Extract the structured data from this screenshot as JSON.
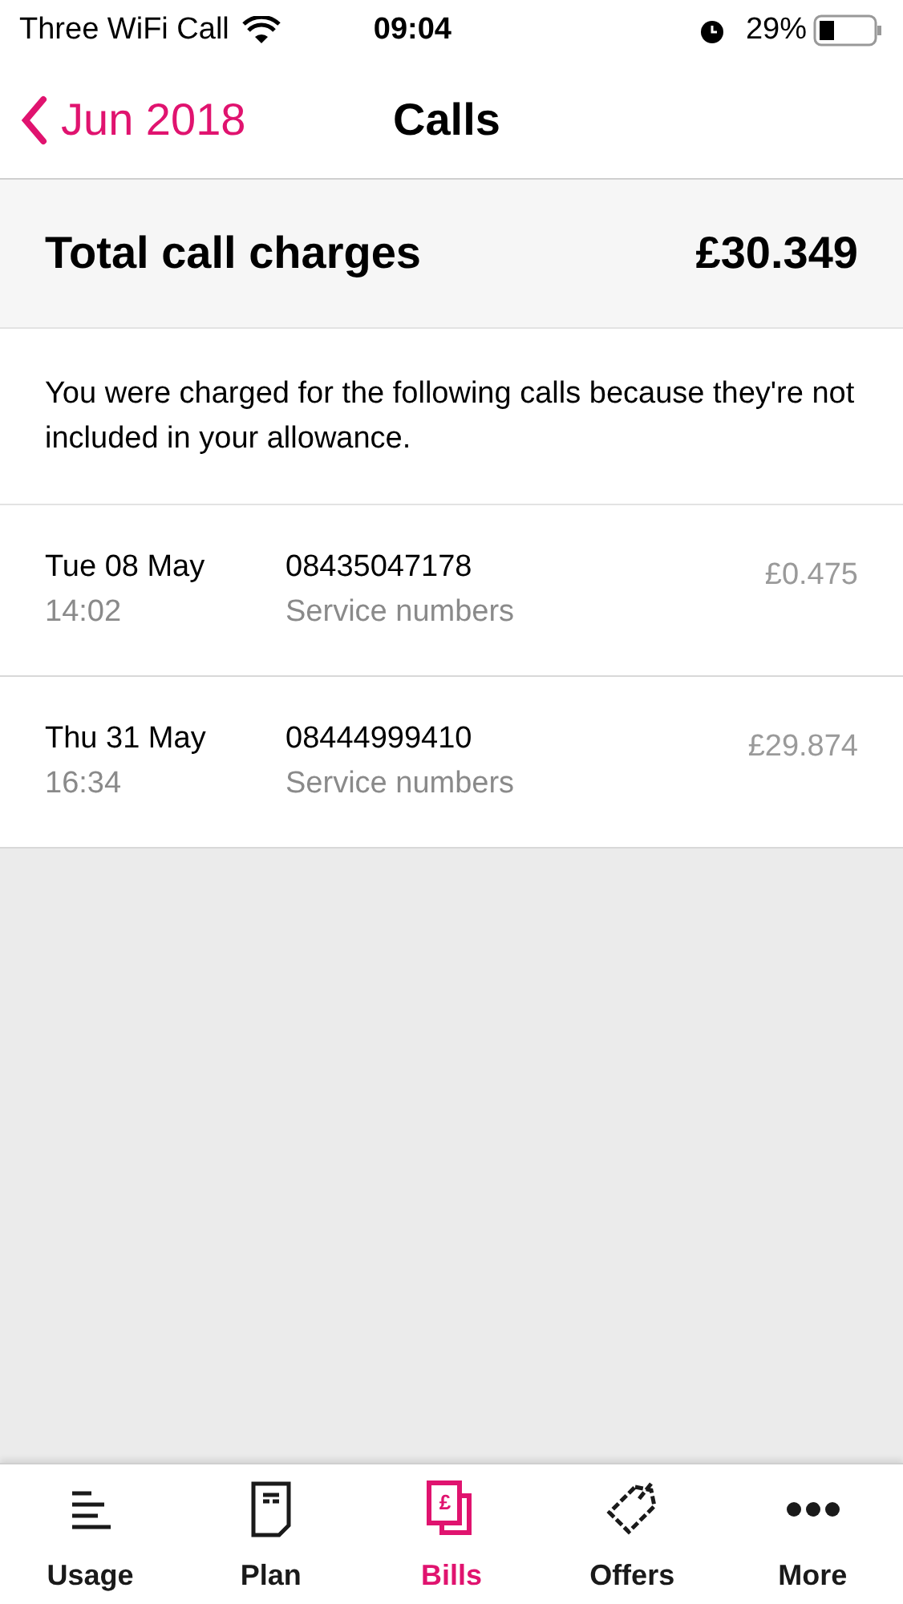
{
  "status_bar": {
    "carrier": "Three WiFi Call",
    "time": "09:04",
    "battery": "29%"
  },
  "nav": {
    "back": "Jun 2018",
    "title": "Calls"
  },
  "total": {
    "label": "Total call charges",
    "amount": "£30.349"
  },
  "intro": "You were charged for the following calls because they're not included in your allowance.",
  "calls": [
    {
      "date": "Tue 08 May",
      "time": "14:02",
      "number": "08435047178",
      "type": "Service numbers",
      "amount": "£0.475"
    },
    {
      "date": "Thu 31 May",
      "time": "16:34",
      "number": "08444999410",
      "type": "Service numbers",
      "amount": "£29.874"
    }
  ],
  "tabs": [
    {
      "kind": "usage",
      "label": "Usage",
      "selected": false
    },
    {
      "kind": "plan",
      "label": "Plan",
      "selected": false
    },
    {
      "kind": "bills",
      "label": "Bills",
      "selected": true,
      "glyph": "£"
    },
    {
      "kind": "offers",
      "label": "Offers",
      "selected": false
    },
    {
      "kind": "more",
      "label": "More",
      "selected": false
    }
  ]
}
